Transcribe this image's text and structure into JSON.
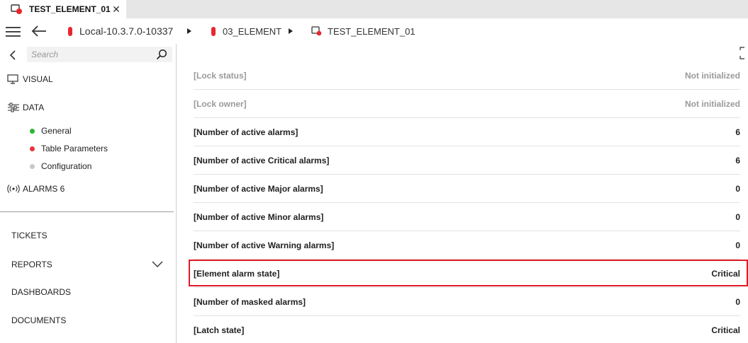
{
  "tab": {
    "title": "TEST_ELEMENT_01",
    "close": "✕"
  },
  "breadcrumb": [
    {
      "label": "Local-10.3.7.0-10337"
    },
    {
      "label": "03_ELEMENT"
    },
    {
      "label": "TEST_ELEMENT_01"
    }
  ],
  "sidebar": {
    "search_placeholder": "Search",
    "nav": [
      {
        "label": "VISUAL"
      },
      {
        "label": "DATA"
      },
      {
        "label": "ALARMS 6"
      }
    ],
    "sub_items": [
      {
        "label": "General",
        "color": "#2db52d"
      },
      {
        "label": "Table Parameters",
        "color": "#e8343d"
      },
      {
        "label": "Configuration",
        "color": "#c8c8c8"
      }
    ],
    "bottom": [
      {
        "label": "TICKETS"
      },
      {
        "label": "REPORTS"
      },
      {
        "label": "DASHBOARDS"
      },
      {
        "label": "DOCUMENTS"
      }
    ]
  },
  "params": [
    {
      "label": "[Lock status]",
      "value": "Not initialized",
      "muted": true
    },
    {
      "label": "[Lock owner]",
      "value": "Not initialized",
      "muted": true
    },
    {
      "label": "[Number of active alarms]",
      "value": "6"
    },
    {
      "label": "[Number of active Critical alarms]",
      "value": "6"
    },
    {
      "label": "[Number of active Major alarms]",
      "value": "0"
    },
    {
      "label": "[Number of active Minor alarms]",
      "value": "0"
    },
    {
      "label": "[Number of active Warning alarms]",
      "value": "0"
    },
    {
      "label": "[Element alarm state]",
      "value": "Critical"
    },
    {
      "label": "[Number of masked alarms]",
      "value": "0"
    },
    {
      "label": "[Latch state]",
      "value": "Critical"
    }
  ],
  "colors": {
    "accent_red": "#e01b24",
    "alarm_red": "#e8262e"
  }
}
